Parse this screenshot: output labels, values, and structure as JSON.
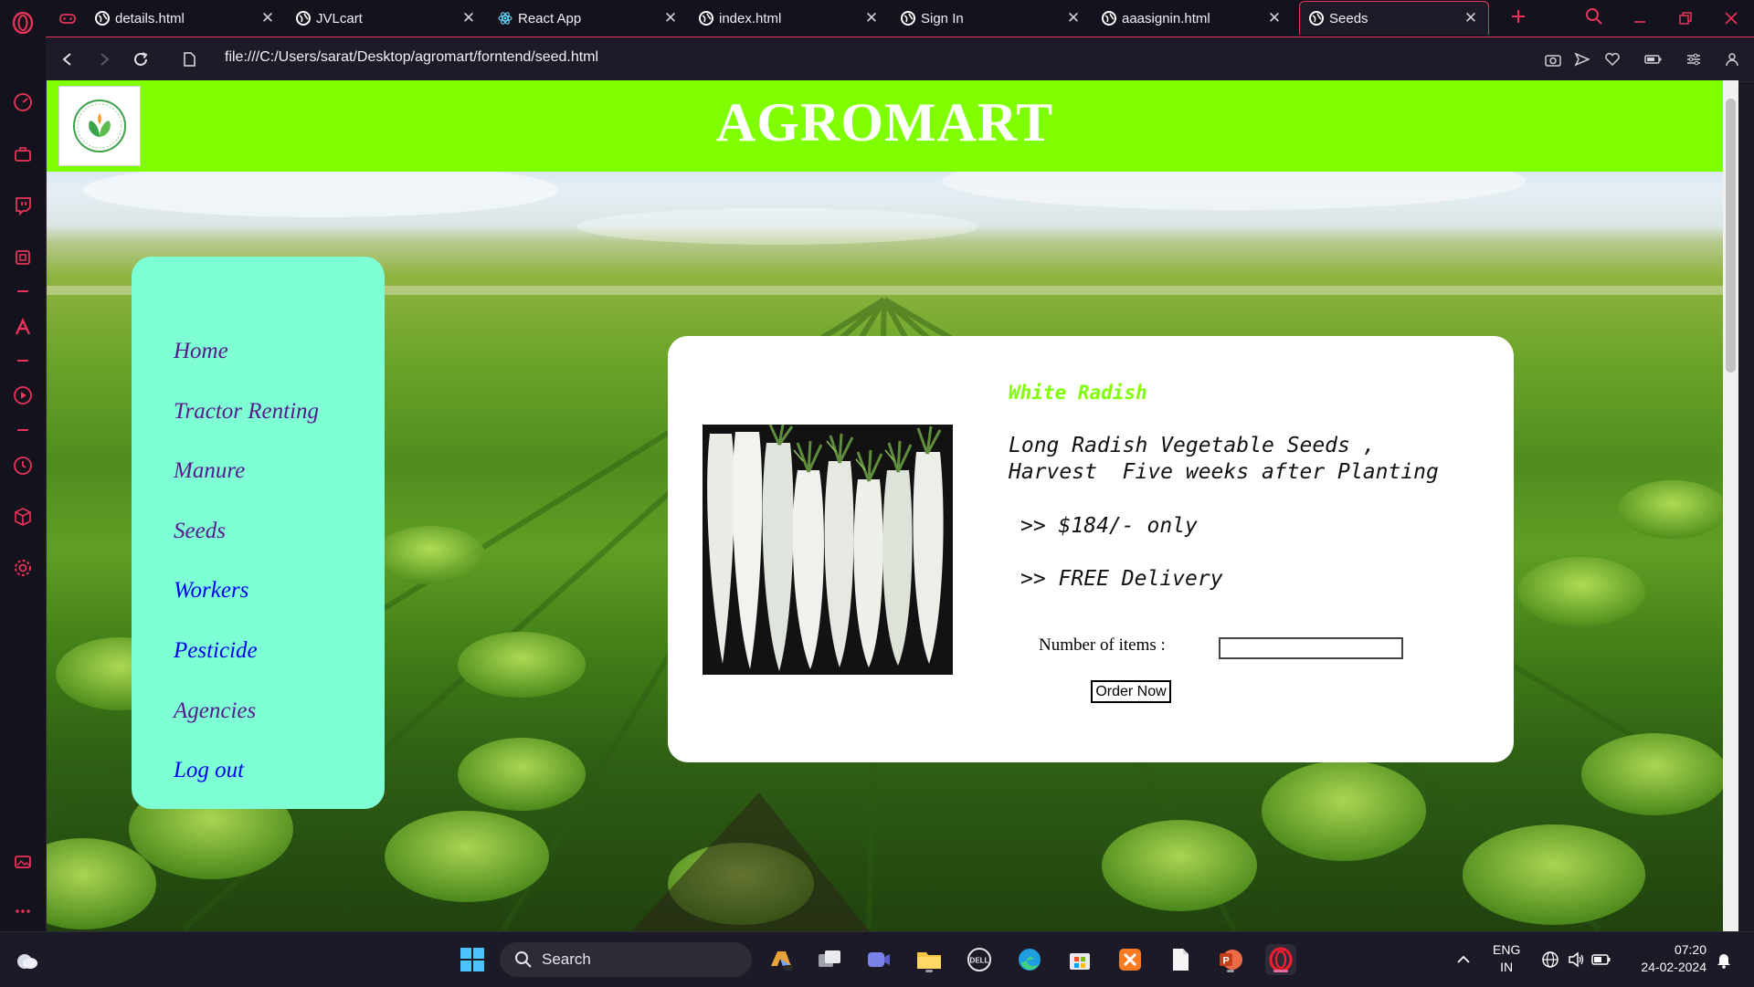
{
  "browser": {
    "tabs": [
      {
        "label": "details.html",
        "active": false
      },
      {
        "label": "JVLcart",
        "active": false
      },
      {
        "label": "React App",
        "active": false
      },
      {
        "label": "index.html",
        "active": false
      },
      {
        "label": "Sign In",
        "active": false
      },
      {
        "label": "aaasignin.html",
        "active": false
      },
      {
        "label": "Seeds",
        "active": true
      }
    ],
    "url": "file:///C:/Users/sarat/Desktop/agromart/forntend/seed.html",
    "accent_color": "#e8345a"
  },
  "site": {
    "title": "AGROMART",
    "header_color": "#7fff00",
    "nav_color": "#7fffd4",
    "nav": [
      {
        "label": "Home",
        "visited": true
      },
      {
        "label": "Tractor Renting",
        "visited": true
      },
      {
        "label": "Manure",
        "visited": true
      },
      {
        "label": "Seeds",
        "visited": true
      },
      {
        "label": "Workers",
        "visited": false
      },
      {
        "label": "Pesticide",
        "visited": false
      },
      {
        "label": "Agencies",
        "visited": true
      },
      {
        "label": "Log out",
        "visited": false
      }
    ]
  },
  "product": {
    "name": "White Radish",
    "description": "Long Radish Vegetable Seeds ,\nHarvest  Five weeks after Planting",
    "price_line": ">> $184/- only",
    "delivery_line": ">> FREE Delivery",
    "quantity_label": "Number of items :",
    "quantity_value": "",
    "order_button": "Order Now"
  },
  "taskbar": {
    "search_label": "Search",
    "language": "ENG",
    "region": "IN",
    "time": "07:20",
    "date": "24-02-2024"
  }
}
